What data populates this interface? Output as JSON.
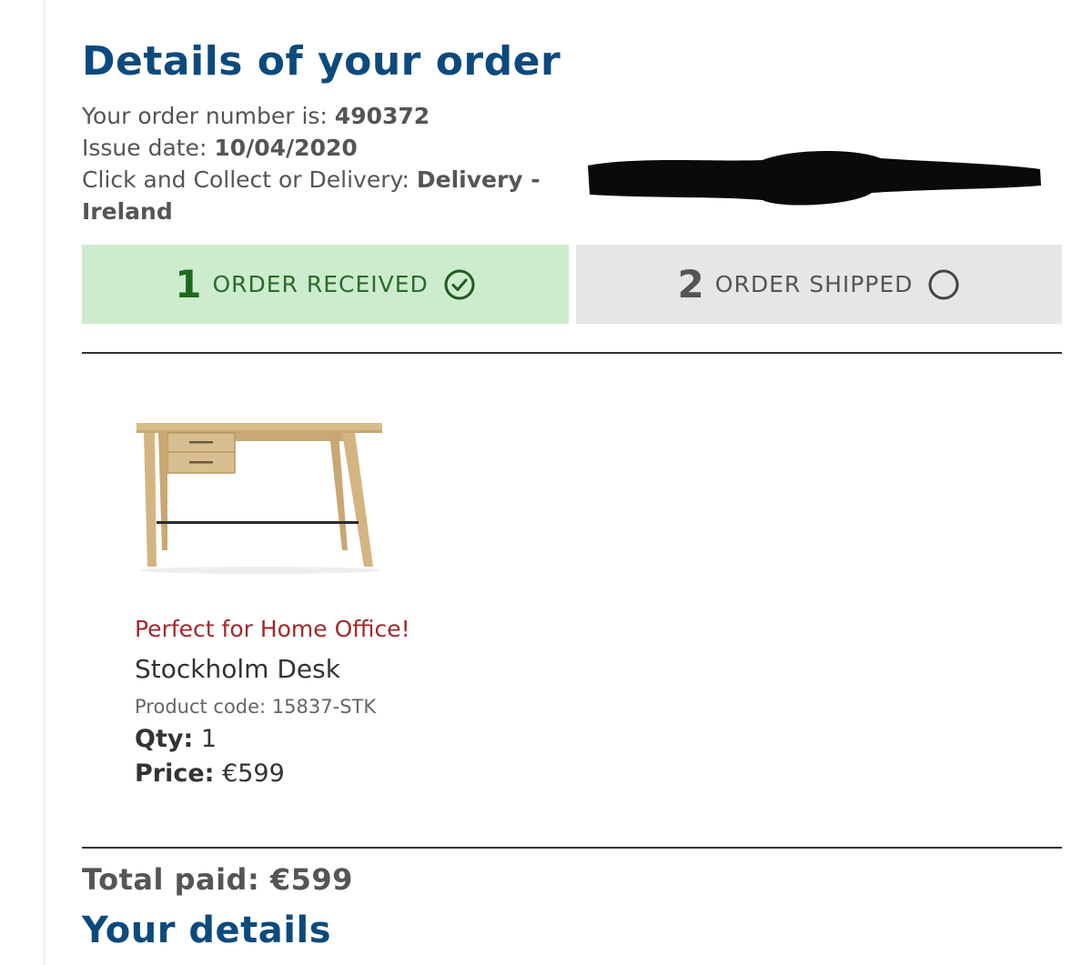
{
  "order": {
    "title": "Details of your order",
    "number_label": "Your order number is: ",
    "number_value": "490372",
    "issue_label": "Issue date: ",
    "issue_value": "10/04/2020",
    "method_label": "Click and Collect or Delivery: ",
    "method_value": "Delivery - Ireland"
  },
  "steps": [
    {
      "number": "1",
      "label": "ORDER RECEIVED",
      "status": "complete",
      "icon": "check-circle-icon"
    },
    {
      "number": "2",
      "label": "ORDER SHIPPED",
      "status": "pending",
      "icon": "empty-circle-icon"
    }
  ],
  "product": {
    "image": "desk-icon",
    "promo": "Perfect for Home Office!",
    "name": "Stockholm Desk",
    "code_label": "Product code: ",
    "code_value": "15837-STK",
    "qty_label": "Qty:",
    "qty_value": "1",
    "price_label": "Price:",
    "price_value": "€599"
  },
  "totals": {
    "total_label": "Total paid: ",
    "total_value": "€599"
  },
  "sections": {
    "your_details": "Your details"
  },
  "colors": {
    "heading_blue": "#0c4a7e",
    "received_bg": "#cdeccd",
    "received_text": "#1f6a1f",
    "shipped_bg": "#e6e6e6",
    "promo_red": "#a3282c"
  }
}
